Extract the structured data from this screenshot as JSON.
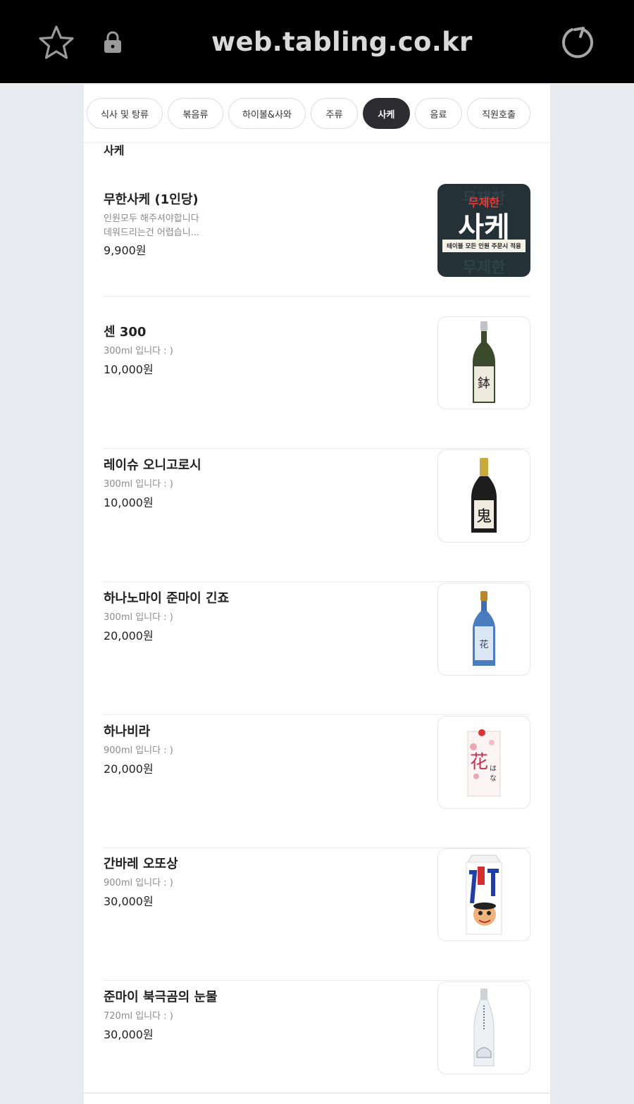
{
  "browser": {
    "url": "web.tabling.co.kr",
    "icons": [
      "star-icon",
      "lock-icon",
      "reload-icon"
    ]
  },
  "tabs": [
    {
      "label": "식사 및 탕류",
      "active": false
    },
    {
      "label": "볶음류",
      "active": false
    },
    {
      "label": "하이볼&사와",
      "active": false
    },
    {
      "label": "주류",
      "active": false
    },
    {
      "label": "사케",
      "active": true
    },
    {
      "label": "음료",
      "active": false
    },
    {
      "label": "직원호출",
      "active": false
    }
  ],
  "section_title": "사케",
  "items": [
    {
      "name": "무한사케 (1인당)",
      "desc_line1": "인원모두 해주셔야합니다",
      "desc_line2": "데워드리는건 어렵습니...",
      "price": "9,900원"
    },
    {
      "name": "센 300",
      "desc_line1": "300ml 입니다 : )",
      "price": "10,000원"
    },
    {
      "name": "레이슈 오니고로시",
      "desc_line1": "300ml 입니다 : )",
      "price": "10,000원"
    },
    {
      "name": "하나노마이 준마이 긴죠",
      "desc_line1": "300ml 입니다 : )",
      "price": "20,000원"
    },
    {
      "name": "하나비라",
      "desc_line1": "900ml 입니다 : )",
      "price": "20,000원"
    },
    {
      "name": "간바레 오또상",
      "desc_line1": "900ml 입니다 : )",
      "price": "30,000원"
    },
    {
      "name": "준마이 북극곰의 눈물",
      "desc_line1": "720ml 입니다 : )",
      "price": "30,000원"
    }
  ],
  "badge": {
    "top": "무제한",
    "main": "사케",
    "strip": "테이블 모든 인원 주문시 적용",
    "bg_word": "무제한"
  },
  "colors": {
    "topbar": "#000000",
    "active_tab": "#2d2d31",
    "badge_bg": "#243238",
    "badge_red": "#e53935"
  }
}
